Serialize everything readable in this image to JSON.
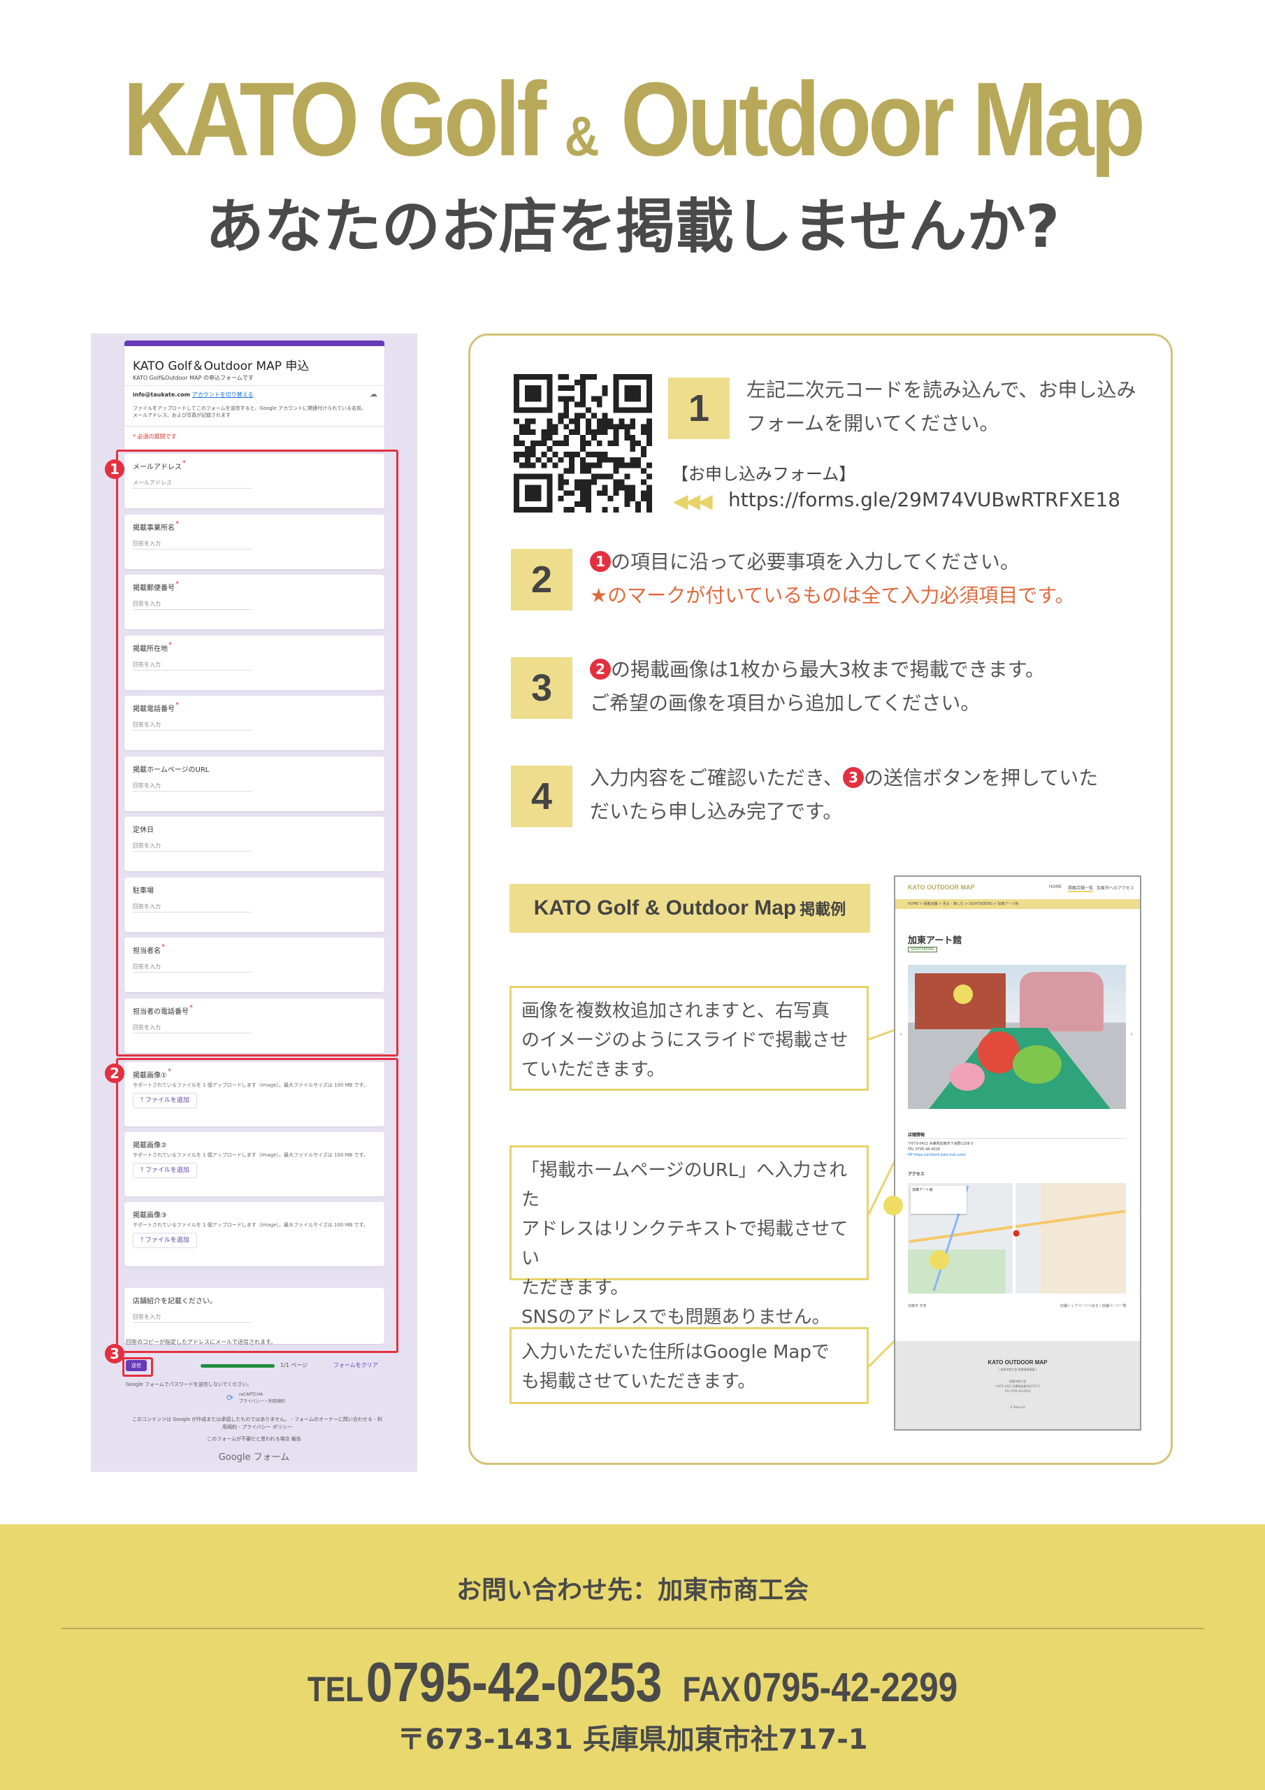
{
  "header": {
    "title_part1": "KATO Golf",
    "title_amp": "&",
    "title_part2": "Outdoor Map",
    "subtitle": "あなたのお店を掲載しませんか?"
  },
  "form": {
    "title": "KATO Golf＆Outdoor MAP 申込",
    "desc": "KATO Golf&Outdoor MAP の申込フォームです",
    "account_email": "info@taukate.com",
    "switch_account": "アカウントを切り替える",
    "upload_notice": "ファイルをアップロードしてこのフォームを送信すると、Google アカウントに関連付けられている名前、メールアドレス、および写真が記録されます",
    "required_notice": "* 必須の質問です",
    "answer_placeholder": "回答を入力",
    "section1_questions": [
      {
        "label": "メールアドレス",
        "required": true,
        "placeholder": "メールアドレス"
      },
      {
        "label": "掲載事業所名",
        "required": true,
        "placeholder": "回答を入力"
      },
      {
        "label": "掲載郵便番号",
        "required": true,
        "placeholder": "回答を入力"
      },
      {
        "label": "掲載所在地",
        "required": true,
        "placeholder": "回答を入力"
      },
      {
        "label": "掲載電話番号",
        "required": true,
        "placeholder": "回答を入力"
      },
      {
        "label": "掲載ホームページのURL",
        "required": false,
        "placeholder": "回答を入力"
      },
      {
        "label": "定休日",
        "required": false,
        "placeholder": "回答を入力"
      },
      {
        "label": "駐車場",
        "required": false,
        "placeholder": "回答を入力"
      },
      {
        "label": "担当者名",
        "required": true,
        "placeholder": "回答を入力"
      },
      {
        "label": "担当者の電話番号",
        "required": true,
        "placeholder": "回答を入力"
      }
    ],
    "image_questions": [
      {
        "label": "掲載画像①",
        "required": true
      },
      {
        "label": "掲載画像②",
        "required": false
      },
      {
        "label": "掲載画像③",
        "required": false
      }
    ],
    "image_note": "サポートされているファイルを 1 個アップロードします（image）。最大ファイルサイズは 100 MB です。",
    "add_file": "ファイルを追加",
    "shop_intro": {
      "label": "店舗紹介を記載ください。",
      "placeholder": "回答を入力"
    },
    "copy_notice": "回答のコピーが指定したアドレスにメールで送信されます。",
    "submit": "送信",
    "page_indicator": "1/1 ページ",
    "clear_form": "フォームをクリア",
    "password_warning": "Google フォームでパスワードを送信しないでください。",
    "recaptcha": "reCAPTCHA",
    "recaptcha_links": "プライバシー・利用規約",
    "footer_note": "このコンテンツは Google が作成または承認したものではありません。 - フォームのオーナーに問い合わせる - 利用規約 - プライバシー ポリシー",
    "report_note": "このフォームが不審だと思われる場合 報告",
    "google_forms": "Google フォーム",
    "badges": [
      "1",
      "2",
      "3"
    ]
  },
  "steps": [
    {
      "num": "1",
      "lines": [
        "左記二次元コードを読み込んで、お申し込み",
        "フォームを開いてください。"
      ]
    },
    {
      "num": "2",
      "line1_badge": "1",
      "line1": "の項目に沿って必要事項を入力してください。",
      "line2": "★のマークが付いているものは全て入力必須項目です。"
    },
    {
      "num": "3",
      "line1_badge": "2",
      "line1": "の掲載画像は1枚から最大3枚まで掲載できます。",
      "line2": "ご希望の画像を項目から追加してください。"
    },
    {
      "num": "4",
      "line1_pre": "入力内容をご確認いただき、",
      "line1_badge": "3",
      "line1_post": "の送信ボタンを押していた",
      "line2": "だいたら申し込み完了です。"
    }
  ],
  "form_link": {
    "label": "【お申し込みフォーム】",
    "arrows": "◀◀◀",
    "url": "https://forms.gle/29M74VUBwRTRFXE18"
  },
  "example": {
    "label_main": "KATO Golf & Outdoor Map",
    "label_suffix": "掲載例",
    "notes": [
      [
        "画像を複数枚追加されますと、右写真",
        "のイメージのようにスライドで掲載させ",
        "ていただきます。"
      ],
      [
        "「掲載ホームページのURL」へ入力された",
        "アドレスはリンクテキストで掲載させてい",
        "ただきます。",
        "SNSのアドレスでも問題ありません。"
      ],
      [
        "入力いただいた住所はGoogle  Mapで",
        "も掲載させていただきます。"
      ]
    ]
  },
  "website": {
    "logo": "KATO OUTDOOR MAP",
    "nav": [
      "HOME",
      "掲載店舗一覧",
      "加東市へのアクセス"
    ],
    "breadcrumb": "HOME > 掲載店舗 > 見る・楽しむ > SIGHTSEEING > 加東アート館",
    "page_title": "加東アート館",
    "tag": "SIGHTSEEING",
    "shop_info_title": "店舗情報",
    "shop_info_lines": [
      "〒673-0412 兵庫県加東市下滝野1258-3",
      "TEL 0795-48-4016",
      "HP https://artwork.kato-kuh.com/"
    ],
    "access_title": "アクセス",
    "map_place": "加東アート館",
    "map_caption": "加東市 天気",
    "map_link": "店舗トップページへ戻る / 店舗ページ一覧",
    "footer_logo": "KATO OUTDOOR MAP",
    "footer_sub": "［ 加東市商工会 地域振興事業 ］",
    "footer_lines": [
      "加東市商工会",
      "〒673-1431 兵庫県加東市社717-1",
      "TEL 0795-42-0253"
    ],
    "copyright": "© Kato-shi"
  },
  "footer": {
    "contact": "お問い合わせ先：加東市商工会",
    "tel_label": "TEL",
    "tel": "0795-42-0253",
    "fax_label": "FAX",
    "fax": "0795-42-2299",
    "address": "〒673-1431  兵庫県加東市社717-1"
  },
  "colors": {
    "gold": "#b8a95a",
    "step_box": "#eedd8c",
    "note_border": "#e8d36a",
    "footer_bg": "#e8d86e",
    "badge_red": "#e3303f",
    "form_bg": "#e6e1f1",
    "form_accent": "#673ab7",
    "required_orange": "#e06a3c"
  }
}
